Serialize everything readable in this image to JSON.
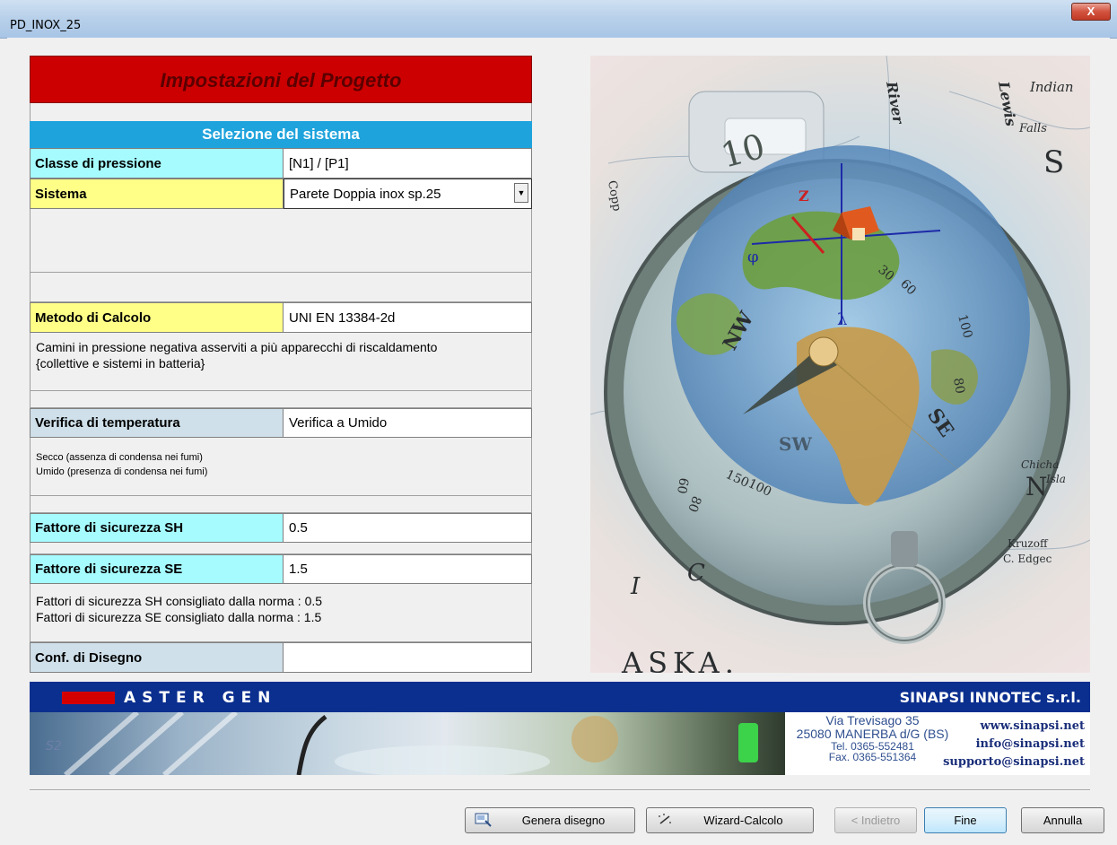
{
  "window": {
    "title": "PD_INOX_25",
    "close_label": "X"
  },
  "panel": {
    "header": "Impostazioni del Progetto",
    "section": "Selezione del sistema",
    "classe_label": "Classe di pressione",
    "classe_value": "[N1] / [P1]",
    "sistema_label": "Sistema",
    "sistema_value": "Parete Doppia inox sp.25",
    "metodo_label": "Metodo di Calcolo",
    "metodo_value": "UNI EN 13384-2d",
    "metodo_desc_1": "Camini in pressione negativa asserviti a più apparecchi di riscaldamento",
    "metodo_desc_2": "{collettive e sistemi in batteria}",
    "verifica_label": "Verifica di temperatura",
    "verifica_value": "Verifica a Umido",
    "verifica_desc_1": "Secco (assenza di condensa nei fumi)",
    "verifica_desc_2": "Umido (presenza di condensa nei fumi)",
    "sh_label": "Fattore di sicurezza SH",
    "sh_value": "0.5",
    "se_label": "Fattore di sicurezza SE",
    "se_value": "1.5",
    "fattori_desc_1": "Fattori di sicurezza SH consigliato dalla norma : 0.5",
    "fattori_desc_2": "Fattori di sicurezza SE consigliato dalla norma : 1.5",
    "conf_label": "Conf. di Disegno",
    "conf_value": ""
  },
  "photo": {
    "map_words": [
      "River",
      "Lewis",
      "Indian",
      "Falls",
      "Copp",
      "Kruzoff",
      "C. Edgec",
      "ASKA.",
      "Chicha",
      "Isla"
    ],
    "compass_letters": [
      "NW",
      "SE",
      "SW",
      "Z",
      "φ",
      "λ"
    ],
    "dial_numbers": [
      "10",
      "30",
      "60",
      "80",
      "100",
      "60",
      "80",
      "150",
      "100"
    ],
    "small_letters": [
      "I",
      "C",
      "S",
      "N"
    ]
  },
  "banner": {
    "left_brand": "ASTER GEN",
    "right_brand": "SINAPSI INNOTEC s.r.l.",
    "badge": "S2",
    "address_1": "Via Trevisago 35",
    "address_2": "25080 MANERBA d/G (BS)",
    "tel": "Tel. 0365-552481",
    "fax": "Fax. 0365-551364",
    "web": "www.sinapsi.net",
    "email_info": "info@sinapsi.net",
    "email_support": "supporto@sinapsi.net"
  },
  "buttons": {
    "genera": "Genera disegno",
    "wizard": "Wizard-Calcolo",
    "indietro": "< Indietro",
    "fine": "Fine",
    "annulla": "Annulla"
  }
}
